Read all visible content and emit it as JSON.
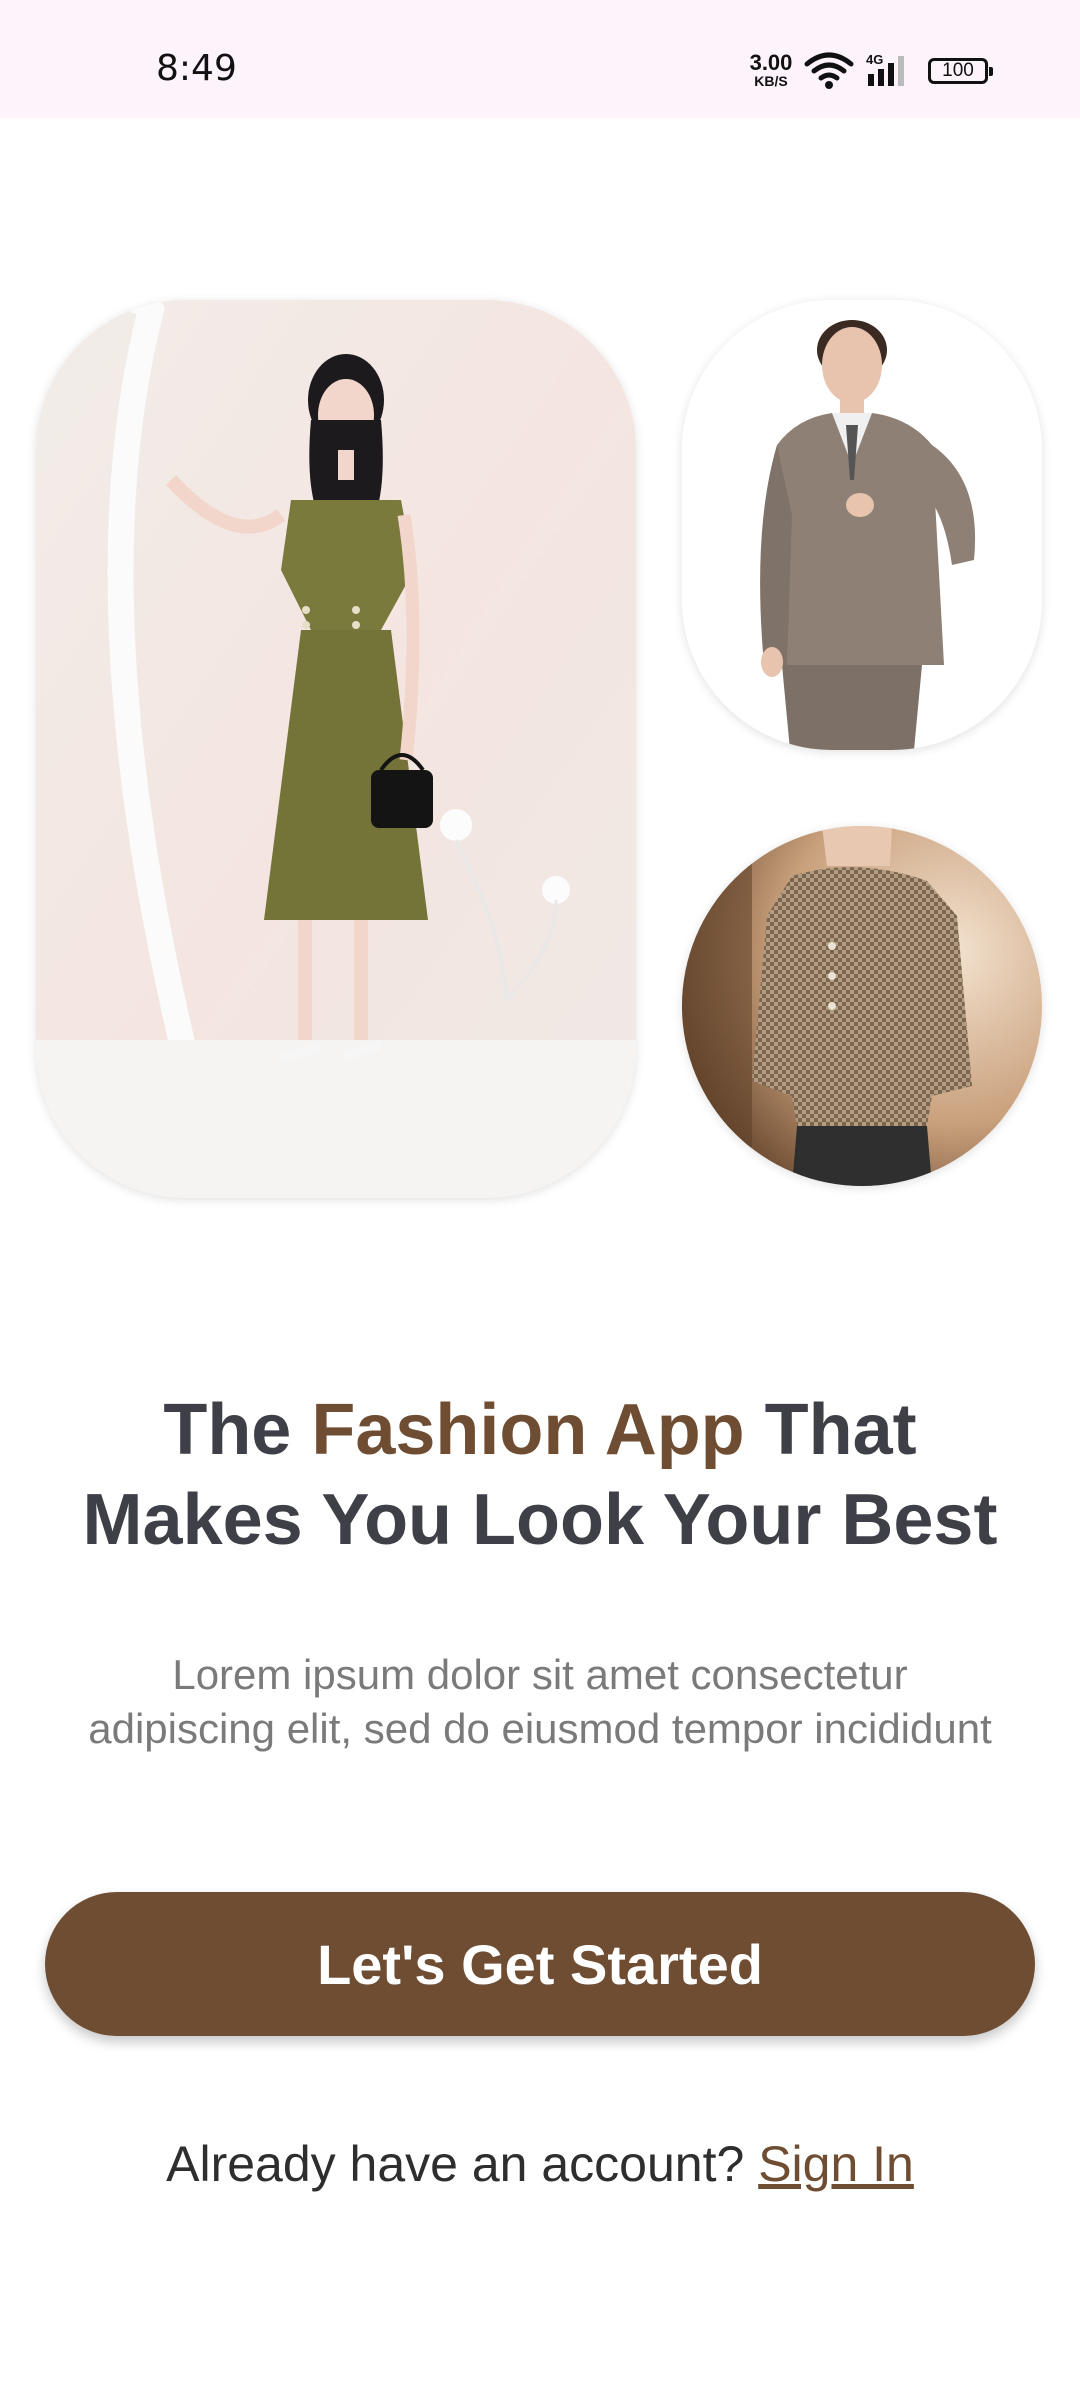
{
  "status_bar": {
    "time": "8:49",
    "net_speed_value": "3.00",
    "net_speed_unit": "KB/S",
    "network_type": "4G",
    "battery": "100",
    "icons": [
      "wifi-icon",
      "signal-icon",
      "battery-icon"
    ]
  },
  "collage": {
    "images": [
      {
        "name": "woman-in-olive-dress"
      },
      {
        "name": "man-in-brown-suit"
      },
      {
        "name": "woman-in-houndstooth-blouse"
      }
    ]
  },
  "headline": {
    "part1": "The ",
    "accent": "Fashion App",
    "part2": " That",
    "line2": "Makes You Look Your Best"
  },
  "subtitle": {
    "line1": "Lorem ipsum dolor sit amet consectetur",
    "line2": "adipiscing elit, sed do eiusmod tempor incididunt"
  },
  "cta": {
    "label": "Let's Get Started"
  },
  "signin": {
    "prompt": "Already have an account? ",
    "link": "Sign In"
  },
  "colors": {
    "accent": "#6f4d33",
    "headline_text": "#3f3f48",
    "subtitle_text": "#7a7a7a",
    "status_bar_bg": "#fdf3fb"
  }
}
